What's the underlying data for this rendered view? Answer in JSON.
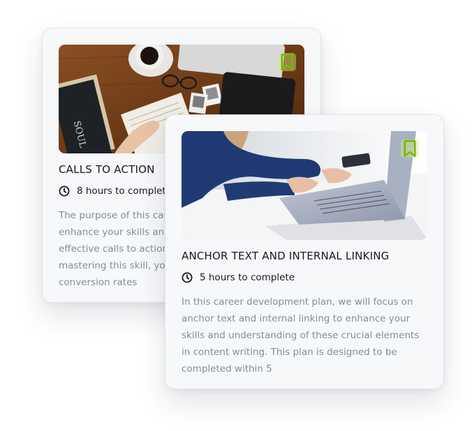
{
  "colors": {
    "accent": "#7ab800",
    "title": "#16181d",
    "description": "#858c97",
    "card_background": "#f7f8fa"
  },
  "cards": [
    {
      "title": "CALLS TO ACTION",
      "duration": "8 hours to complete",
      "description": "The purpose of this career development plan is to enhance your skills and knowledge in crafting effective calls to action in content writing. By mastering this skill, you will be able to drive conversion rates",
      "icons": {
        "bookmark": "bookmark-icon",
        "clock": "clock-icon"
      },
      "image": "desk-with-coffee-books-laptop"
    },
    {
      "title": "ANCHOR TEXT AND INTERNAL LINKING",
      "duration": "5 hours to complete",
      "description": "In this career development plan, we will focus on anchor text and internal linking to enhance your skills and understanding of these crucial elements in content writing. This plan is designed to be completed within 5",
      "icons": {
        "bookmark": "bookmark-icon",
        "clock": "clock-icon"
      },
      "image": "hands-typing-on-laptop"
    }
  ]
}
